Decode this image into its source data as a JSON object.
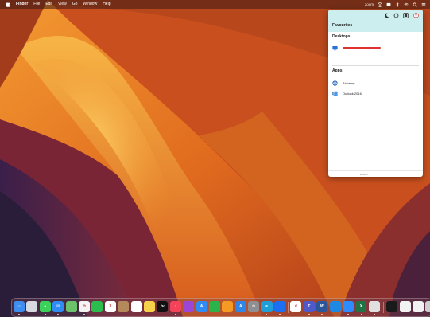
{
  "menubar": {
    "app_name": "Finder",
    "menus": [
      "File",
      "Edit",
      "View",
      "Go",
      "Window",
      "Help"
    ],
    "status_text": "zoom"
  },
  "panel": {
    "tab": "Favourites",
    "desktops_title": "Desktops",
    "apps_title": "Apps",
    "apps": [
      "Alchemy",
      "Outlook 2016"
    ],
    "footer_prefix": "Version"
  },
  "dock": {
    "apps": [
      {
        "name": "finder-icon",
        "color": "#3d8ef0",
        "glyph": "☺"
      },
      {
        "name": "launchpad-icon",
        "color": "#d9d9e0",
        "glyph": ""
      },
      {
        "name": "messages-icon",
        "color": "#3bd15a",
        "glyph": "●"
      },
      {
        "name": "mail-icon",
        "color": "#2f8cf5",
        "glyph": "✉"
      },
      {
        "name": "maps-icon",
        "color": "#6cc26a",
        "glyph": ""
      },
      {
        "name": "photos-icon",
        "color": "#f4f4f4",
        "glyph": "✿"
      },
      {
        "name": "facetime-icon",
        "color": "#2bbd4e",
        "glyph": ""
      },
      {
        "name": "calendar-icon",
        "color": "#ffffff",
        "glyph": "3"
      },
      {
        "name": "contacts-icon",
        "color": "#b48a5a",
        "glyph": ""
      },
      {
        "name": "reminders-icon",
        "color": "#ffffff",
        "glyph": ""
      },
      {
        "name": "notes-icon",
        "color": "#f6d24b",
        "glyph": ""
      },
      {
        "name": "appletv-icon",
        "color": "#111111",
        "glyph": "tv"
      },
      {
        "name": "music-icon",
        "color": "#f2435a",
        "glyph": "♫"
      },
      {
        "name": "podcasts-icon",
        "color": "#9b46d6",
        "glyph": ""
      },
      {
        "name": "appstore-icon",
        "color": "#2f8cf5",
        "glyph": "A"
      },
      {
        "name": "numbers-icon",
        "color": "#2ab34b",
        "glyph": ""
      },
      {
        "name": "pages-icon",
        "color": "#f59a23",
        "glyph": ""
      },
      {
        "name": "xcode-icon",
        "color": "#2f86e8",
        "glyph": "A"
      },
      {
        "name": "settings-icon",
        "color": "#8e8e93",
        "glyph": "⚙"
      },
      {
        "name": "edge-icon",
        "color": "#1f9fd8",
        "glyph": "e"
      },
      {
        "name": "safari-icon",
        "color": "#1d6ff2",
        "glyph": ""
      },
      {
        "name": "slack-icon",
        "color": "#ffffff",
        "glyph": "#"
      },
      {
        "name": "teams-icon",
        "color": "#5059c9",
        "glyph": "T"
      },
      {
        "name": "word-icon",
        "color": "#2b579a",
        "glyph": "W"
      },
      {
        "name": "vscode-icon",
        "color": "#1e88e5",
        "glyph": ""
      },
      {
        "name": "zoom-icon",
        "color": "#2d8cff",
        "glyph": ""
      },
      {
        "name": "excel-icon",
        "color": "#217346",
        "glyph": "X"
      },
      {
        "name": "chrome-icon",
        "color": "#e0e0e0",
        "glyph": ""
      },
      {
        "name": "terminal-icon",
        "color": "#1a1a1a",
        "glyph": ""
      },
      {
        "name": "preview-window-icon",
        "color": "#f2f2f2",
        "glyph": ""
      },
      {
        "name": "preview-window-icon-2",
        "color": "#f2f2f2",
        "glyph": ""
      },
      {
        "name": "trash-icon",
        "color": "#cfcfcf",
        "glyph": ""
      }
    ]
  }
}
